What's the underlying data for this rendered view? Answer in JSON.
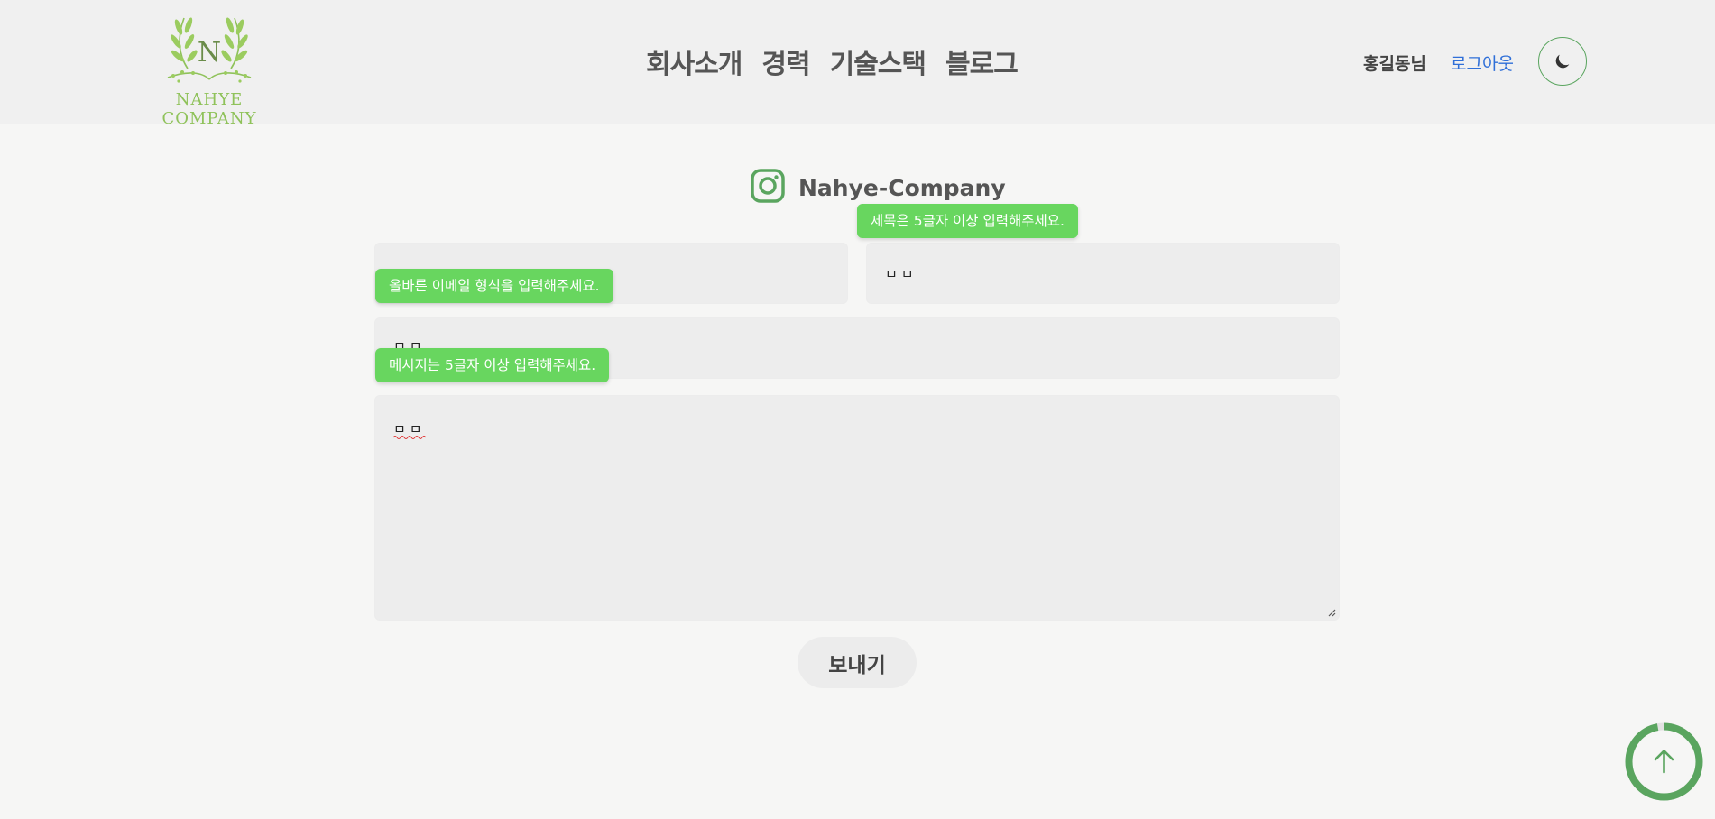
{
  "brand": {
    "logo_letter": "N",
    "name": "NAHYE COMPANY"
  },
  "nav": {
    "items": [
      "회사소개",
      "경력",
      "기술스택",
      "블로그"
    ]
  },
  "user": {
    "name": "홍길동님",
    "logout_label": "로그아웃"
  },
  "theme_toggle": {
    "icon": "moon-icon"
  },
  "contact": {
    "instagram_handle": "Nahye-Company"
  },
  "form": {
    "email_value": "",
    "title_value": "ㅁㅁ",
    "row2_value": "ㅁㅁ",
    "message_value": "ㅁㅁ",
    "title_tooltip": "제목은 5글자 이상 입력해주세요.",
    "email_tooltip": "올바른 이메일 형식을 입력해주세요.",
    "message_tooltip": "메시지는 5글자 이상 입력해주세요.",
    "submit_label": "보내기"
  },
  "scroll_top": {
    "icon": "arrow-up-icon",
    "progress": 0.97
  },
  "colors": {
    "brand_green": "#8fc25a",
    "accent_green": "#5aa55f",
    "tooltip_green": "#68d65f",
    "link_blue": "#2f6fd8"
  }
}
